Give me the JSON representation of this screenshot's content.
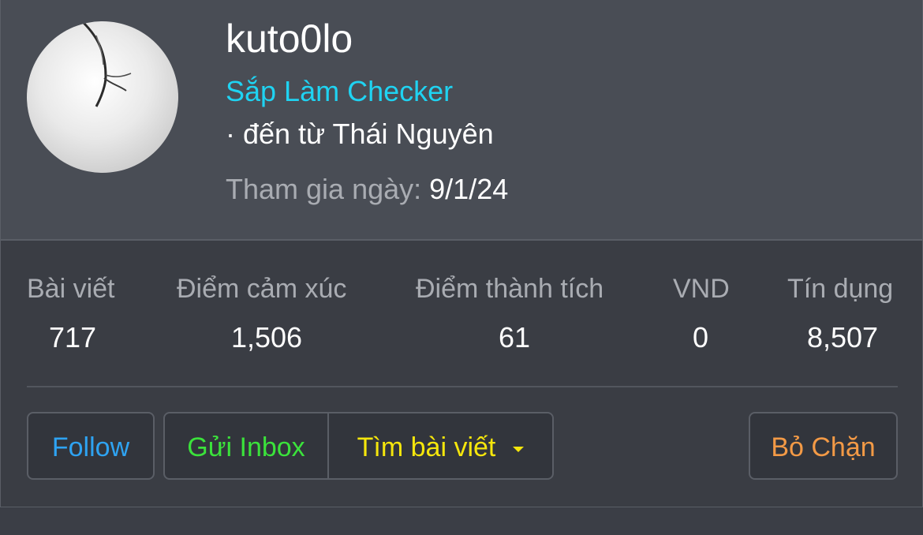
{
  "profile": {
    "username": "kuto0lo",
    "user_title": "Sắp Làm Checker",
    "location": "· đến từ Thái Nguyên",
    "joined_label": "Tham gia ngày:",
    "joined_date": "9/1/24"
  },
  "stats": [
    {
      "label": "Bài viết",
      "value": "717"
    },
    {
      "label": "Điểm cảm xúc",
      "value": "1,506"
    },
    {
      "label": "Điểm thành tích",
      "value": "61"
    },
    {
      "label": "VND",
      "value": "0"
    },
    {
      "label": "Tín dụng",
      "value": "8,507"
    }
  ],
  "actions": {
    "follow": "Follow",
    "send_inbox": "Gửi Inbox",
    "find_posts": "Tìm bài viết",
    "unblock": "Bỏ Chặn"
  },
  "colors": {
    "header_bg": "#494d55",
    "card_bg": "#3a3d44",
    "title": "#1fd3f2",
    "follow": "#2ea3f2",
    "inbox": "#3be23b",
    "find": "#f5e60c",
    "unblock": "#f39a46"
  }
}
